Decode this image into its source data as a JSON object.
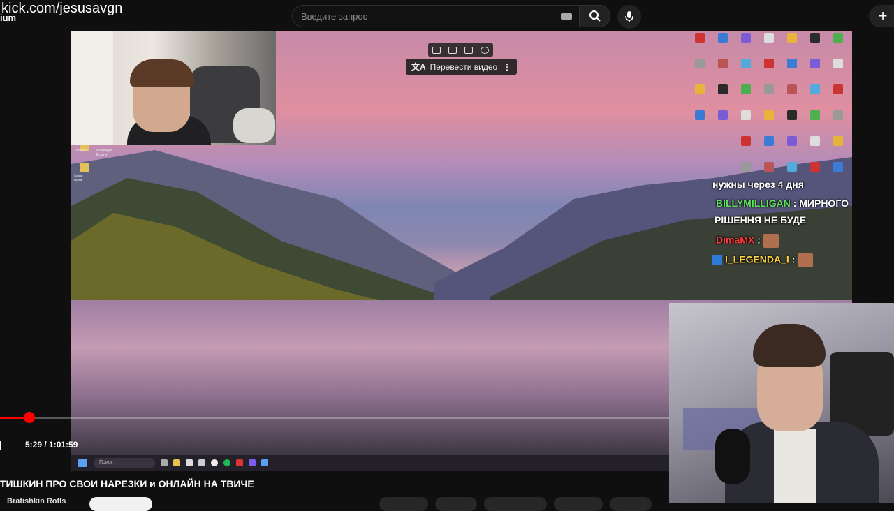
{
  "stream_overlay": {
    "url": "kick.com/jesusavgn",
    "logo_fragment": "ium"
  },
  "header": {
    "search_placeholder": "Введите запрос",
    "icons": [
      "keyboard-icon",
      "search-icon",
      "mic-icon",
      "create-icon"
    ]
  },
  "video_overlay": {
    "translate_label": "Перевести видео",
    "toolbar_icons": [
      "screenshot-icon",
      "record-icon",
      "note-icon",
      "translate-icon"
    ]
  },
  "desktop": {
    "taskbar_search": "Поиск",
    "left_icon_labels": [
      "Yandex",
      "Wallpaper Engine",
      "Новая папка"
    ]
  },
  "chat": {
    "messages": [
      {
        "user": "",
        "text": "нужны через 4 дня"
      },
      {
        "user": "BILLYMILLIGAN",
        "text": " : МИРНОГО"
      },
      {
        "user": "",
        "text": "РІШЕННЯ НЕ БУДЕ"
      },
      {
        "user": "DimaMX",
        "text": " :"
      },
      {
        "user": "I_LEGENDA_I",
        "text": " :"
      }
    ]
  },
  "player": {
    "time": "5:29 / 1:01:59",
    "progress_fraction": 0.0886
  },
  "video_info": {
    "title": "ТИШКИН ПРО СВОИ НАРЕЗКИ и ОНЛАЙН НА ТВИЧЕ",
    "channel": "Bratishkin Rofls"
  },
  "colors": {
    "accent_red": "#ff0000",
    "background": "#0f0f0f"
  }
}
